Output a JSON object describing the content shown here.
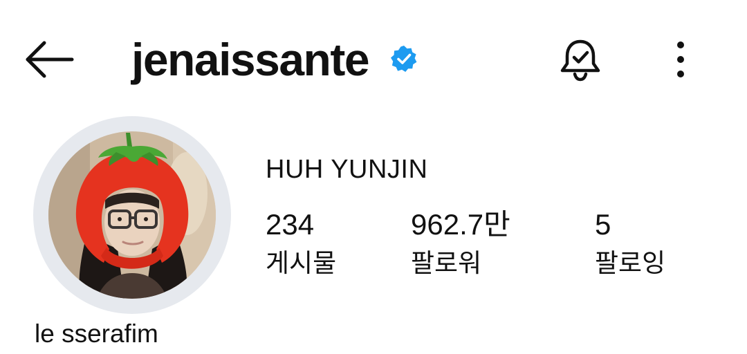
{
  "header": {
    "username": "jenaissante",
    "back_icon": "arrow-left-icon",
    "verified_icon": "verified-badge-icon",
    "notification_icon": "bell-check-icon",
    "more_icon": "more-vertical-icon"
  },
  "profile": {
    "display_name": "HUH YUNJIN",
    "note": "le sserafim",
    "avatar_description_icon": "profile-avatar"
  },
  "stats": [
    {
      "value": "234",
      "label": "게시물"
    },
    {
      "value": "962.7만",
      "label": "팔로워"
    },
    {
      "value": "5",
      "label": "팔로잉"
    }
  ],
  "colors": {
    "verified": "#1d9bf0",
    "avatar_ring": "#e6e9ee",
    "text": "#111111"
  }
}
